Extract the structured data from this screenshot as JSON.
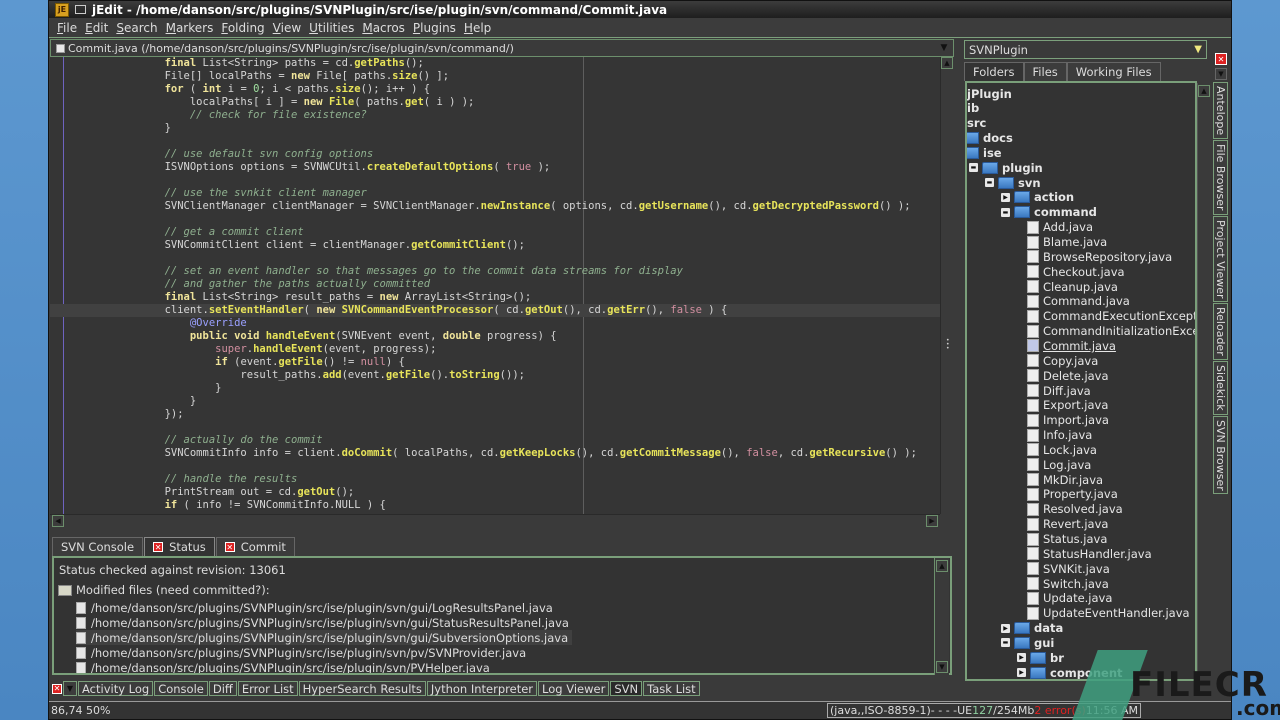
{
  "window": {
    "title": "jEdit - /home/danson/src/plugins/SVNPlugin/src/ise/plugin/svn/command/Commit.java",
    "app_icon": "jedit-icon"
  },
  "menubar": [
    "File",
    "Edit",
    "Search",
    "Markers",
    "Folding",
    "View",
    "Utilities",
    "Macros",
    "Plugins",
    "Help"
  ],
  "buffer": {
    "label": "Commit.java (/home/danson/src/plugins/SVNPlugin/src/ise/plugin/svn/command/)"
  },
  "editor": {
    "lines": [
      [
        [
          "",
          "        "
        ],
        [
          "k",
          "final"
        ],
        [
          "",
          " List<String> paths = cd."
        ],
        [
          "f",
          "getPaths"
        ],
        [
          "",
          "();"
        ]
      ],
      [
        [
          "",
          "        File[] localPaths = "
        ],
        [
          "k",
          "new"
        ],
        [
          "",
          " File[ paths."
        ],
        [
          "f",
          "size"
        ],
        [
          "",
          "() ];"
        ]
      ],
      [
        [
          "",
          "        "
        ],
        [
          "k",
          "for"
        ],
        [
          "",
          " ( "
        ],
        [
          "k",
          "int"
        ],
        [
          "",
          " i = "
        ],
        [
          "n",
          "0"
        ],
        [
          "",
          "; i < paths."
        ],
        [
          "f",
          "size"
        ],
        [
          "",
          "(); i++ ) {"
        ]
      ],
      [
        [
          "",
          "            localPaths[ i ] = "
        ],
        [
          "k",
          "new"
        ],
        [
          "",
          " "
        ],
        [
          "f",
          "File"
        ],
        [
          "",
          "( paths."
        ],
        [
          "f",
          "get"
        ],
        [
          "",
          "( i ) );"
        ]
      ],
      [
        [
          "c",
          "            // check for file existence?"
        ]
      ],
      [
        [
          "",
          "        }"
        ]
      ],
      [
        [
          "",
          ""
        ]
      ],
      [
        [
          "c",
          "        // use default svn config options"
        ]
      ],
      [
        [
          "",
          "        ISVNOptions options = SVNWCUtil."
        ],
        [
          "f",
          "createDefaultOptions"
        ],
        [
          "",
          "( "
        ],
        [
          "l",
          "true"
        ],
        [
          "",
          " );"
        ]
      ],
      [
        [
          "",
          ""
        ]
      ],
      [
        [
          "c",
          "        // use the svnkit client manager"
        ]
      ],
      [
        [
          "",
          "        SVNClientManager clientManager = SVNClientManager."
        ],
        [
          "f",
          "newInstance"
        ],
        [
          "",
          "( options, cd."
        ],
        [
          "f",
          "getUsername"
        ],
        [
          "",
          "(), cd."
        ],
        [
          "f",
          "getDecryptedPassword"
        ],
        [
          "",
          "() );"
        ]
      ],
      [
        [
          "",
          ""
        ]
      ],
      [
        [
          "c",
          "        // get a commit client"
        ]
      ],
      [
        [
          "",
          "        SVNCommitClient client = clientManager."
        ],
        [
          "f",
          "getCommitClient"
        ],
        [
          "",
          "();"
        ]
      ],
      [
        [
          "",
          ""
        ]
      ],
      [
        [
          "c",
          "        // set an event handler so that messages go to the commit data streams for display"
        ]
      ],
      [
        [
          "c",
          "        // and gather the paths actually committed"
        ]
      ],
      [
        [
          "",
          "        "
        ],
        [
          "k",
          "final"
        ],
        [
          "",
          " List<String> result_paths = "
        ],
        [
          "k",
          "new"
        ],
        [
          "",
          " ArrayList<String>();"
        ]
      ],
      [
        [
          "",
          "        client."
        ],
        [
          "f",
          "setEventHandler"
        ],
        [
          "",
          "( "
        ],
        [
          "k",
          "new"
        ],
        [
          "",
          " "
        ],
        [
          "f",
          "SVNCommandEventProcessor"
        ],
        [
          "",
          "( cd."
        ],
        [
          "f",
          "getOut"
        ],
        [
          "",
          "(), cd."
        ],
        [
          "f",
          "getErr"
        ],
        [
          "",
          "(), "
        ],
        [
          "l",
          "false"
        ],
        [
          "",
          " ) {"
        ]
      ],
      [
        [
          "a",
          "            @Override"
        ]
      ],
      [
        [
          "",
          "            "
        ],
        [
          "k",
          "public void"
        ],
        [
          "",
          " "
        ],
        [
          "f",
          "handleEvent"
        ],
        [
          "",
          "(SVNEvent event, "
        ],
        [
          "k",
          "double"
        ],
        [
          "",
          " progress) {"
        ]
      ],
      [
        [
          "",
          "                "
        ],
        [
          "l",
          "super"
        ],
        [
          "",
          "."
        ],
        [
          "f",
          "handleEvent"
        ],
        [
          "",
          "(event, progress);"
        ]
      ],
      [
        [
          "",
          "                "
        ],
        [
          "k",
          "if"
        ],
        [
          "",
          " (event."
        ],
        [
          "f",
          "getFile"
        ],
        [
          "",
          "() != "
        ],
        [
          "l",
          "null"
        ],
        [
          "",
          ") {"
        ]
      ],
      [
        [
          "",
          "                    result_paths."
        ],
        [
          "f",
          "add"
        ],
        [
          "",
          "(event."
        ],
        [
          "f",
          "getFile"
        ],
        [
          "",
          "()."
        ],
        [
          "f",
          "toString"
        ],
        [
          "",
          "());"
        ]
      ],
      [
        [
          "",
          "                }"
        ]
      ],
      [
        [
          "",
          "            }"
        ]
      ],
      [
        [
          "",
          "        });"
        ]
      ],
      [
        [
          "",
          ""
        ]
      ],
      [
        [
          "c",
          "        // actually do the commit"
        ]
      ],
      [
        [
          "",
          "        SVNCommitInfo info = client."
        ],
        [
          "f",
          "doCommit"
        ],
        [
          "",
          "( localPaths, cd."
        ],
        [
          "f",
          "getKeepLocks"
        ],
        [
          "",
          "(), cd."
        ],
        [
          "f",
          "getCommitMessage"
        ],
        [
          "",
          "(), "
        ],
        [
          "l",
          "false"
        ],
        [
          "",
          ", cd."
        ],
        [
          "f",
          "getRecursive"
        ],
        [
          "",
          "() );"
        ]
      ],
      [
        [
          "",
          ""
        ]
      ],
      [
        [
          "c",
          "        // handle the results"
        ]
      ],
      [
        [
          "",
          "        PrintStream out = cd."
        ],
        [
          "f",
          "getOut"
        ],
        [
          "",
          "();"
        ]
      ],
      [
        [
          "",
          "        "
        ],
        [
          "k",
          "if"
        ],
        [
          "",
          " ( info != SVNCommitInfo.NULL ) {"
        ]
      ]
    ],
    "current_line_index": 19
  },
  "bottom_panel": {
    "tabs": [
      {
        "label": "SVN Console",
        "closable": false,
        "selected": false
      },
      {
        "label": "Status",
        "closable": true,
        "selected": true
      },
      {
        "label": "Commit",
        "closable": true,
        "selected": false
      }
    ],
    "status_line": "Status checked against revision: 13061",
    "modified_header": "Modified files (need committed?):",
    "files": [
      "/home/danson/src/plugins/SVNPlugin/src/ise/plugin/svn/gui/LogResultsPanel.java",
      "/home/danson/src/plugins/SVNPlugin/src/ise/plugin/svn/gui/StatusResultsPanel.java",
      "/home/danson/src/plugins/SVNPlugin/src/ise/plugin/svn/gui/SubversionOptions.java",
      "/home/danson/src/plugins/SVNPlugin/src/ise/plugin/svn/pv/SVNProvider.java",
      "/home/danson/src/plugins/SVNPlugin/src/ise/plugin/svn/PVHelper.java"
    ],
    "highlighted_file_index": 2
  },
  "dockbar": {
    "buttons": [
      "Activity Log",
      "Console",
      "Diff",
      "Error List",
      "HyperSearch Results",
      "Jython Interpreter",
      "Log Viewer",
      "SVN",
      "Task List"
    ],
    "selected": "SVN"
  },
  "statusbar": {
    "caret": "86,74 50%",
    "mode": "(java,,ISO-8859-1)- - - -UE",
    "memory_used": "127",
    "memory_total": "/254Mb",
    "errors": "2 error(s)",
    "time": "11:56 AM"
  },
  "right_panel": {
    "project": "SVNPlugin",
    "tabs": [
      {
        "label": "Folders",
        "selected": true
      },
      {
        "label": "Files",
        "selected": false
      },
      {
        "label": "Working Files",
        "selected": false
      }
    ],
    "tree": [
      {
        "label": "jPlugin",
        "depth": 0,
        "type": "root",
        "bold": true
      },
      {
        "label": "ib",
        "depth": 0,
        "type": "root",
        "bold": true
      },
      {
        "label": "src",
        "depth": 0,
        "type": "root",
        "bold": true
      },
      {
        "label": "docs",
        "depth": 1,
        "type": "folder",
        "bold": true
      },
      {
        "label": "ise",
        "depth": 1,
        "type": "folder",
        "bold": true
      },
      {
        "label": "plugin",
        "depth": 2,
        "type": "folder",
        "bold": true,
        "expanded": true
      },
      {
        "label": "svn",
        "depth": 3,
        "type": "folder",
        "bold": true,
        "expanded": true
      },
      {
        "label": "action",
        "depth": 4,
        "type": "folder",
        "bold": true,
        "expanded": false
      },
      {
        "label": "command",
        "depth": 4,
        "type": "folder",
        "bold": true,
        "expanded": true
      },
      {
        "label": "Add.java",
        "depth": 5,
        "type": "file"
      },
      {
        "label": "Blame.java",
        "depth": 5,
        "type": "file"
      },
      {
        "label": "BrowseRepository.java",
        "depth": 5,
        "type": "file"
      },
      {
        "label": "Checkout.java",
        "depth": 5,
        "type": "file"
      },
      {
        "label": "Cleanup.java",
        "depth": 5,
        "type": "file"
      },
      {
        "label": "Command.java",
        "depth": 5,
        "type": "file"
      },
      {
        "label": "CommandExecutionExceptio",
        "depth": 5,
        "type": "file"
      },
      {
        "label": "CommandInitializationExcept",
        "depth": 5,
        "type": "file"
      },
      {
        "label": "Commit.java",
        "depth": 5,
        "type": "file",
        "current": true
      },
      {
        "label": "Copy.java",
        "depth": 5,
        "type": "file"
      },
      {
        "label": "Delete.java",
        "depth": 5,
        "type": "file"
      },
      {
        "label": "Diff.java",
        "depth": 5,
        "type": "file"
      },
      {
        "label": "Export.java",
        "depth": 5,
        "type": "file"
      },
      {
        "label": "Import.java",
        "depth": 5,
        "type": "file"
      },
      {
        "label": "Info.java",
        "depth": 5,
        "type": "file"
      },
      {
        "label": "Lock.java",
        "depth": 5,
        "type": "file"
      },
      {
        "label": "Log.java",
        "depth": 5,
        "type": "file"
      },
      {
        "label": "MkDir.java",
        "depth": 5,
        "type": "file"
      },
      {
        "label": "Property.java",
        "depth": 5,
        "type": "file"
      },
      {
        "label": "Resolved.java",
        "depth": 5,
        "type": "file"
      },
      {
        "label": "Revert.java",
        "depth": 5,
        "type": "file"
      },
      {
        "label": "Status.java",
        "depth": 5,
        "type": "file"
      },
      {
        "label": "StatusHandler.java",
        "depth": 5,
        "type": "file"
      },
      {
        "label": "SVNKit.java",
        "depth": 5,
        "type": "file"
      },
      {
        "label": "Switch.java",
        "depth": 5,
        "type": "file"
      },
      {
        "label": "Update.java",
        "depth": 5,
        "type": "file"
      },
      {
        "label": "UpdateEventHandler.java",
        "depth": 5,
        "type": "file"
      },
      {
        "label": "data",
        "depth": 4,
        "type": "folder",
        "bold": true,
        "expanded": false
      },
      {
        "label": "gui",
        "depth": 4,
        "type": "folder",
        "bold": true,
        "expanded": true
      },
      {
        "label": "br",
        "depth": 5,
        "type": "folder",
        "bold": true,
        "expanded": false
      },
      {
        "label": "component",
        "depth": 5,
        "type": "folder",
        "bold": true,
        "expanded": false
      }
    ]
  },
  "side_tabs": [
    "Antelope",
    "File Browser",
    "Project Viewer",
    "Reloader",
    "Sidekick",
    "SVN Browser"
  ],
  "watermark": {
    "text": "FILECR",
    "suffix": ".com"
  }
}
